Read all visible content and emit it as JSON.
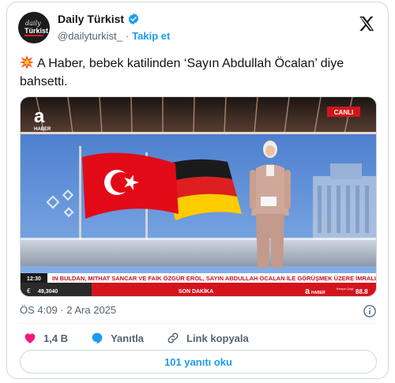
{
  "author": {
    "display_name": "Daily Türkist",
    "handle": "@dailyturkist_",
    "separator": "·",
    "follow_label": "Takip et",
    "avatar_line1": "daily",
    "avatar_line2": "Türkist"
  },
  "tweet": {
    "text": "A Haber, bebek katilinden ‘Sayın Abdullah Öcalan’ diye bahsetti."
  },
  "media": {
    "channel_logo": "a",
    "channel_sublabel": "HABER",
    "live_badge": "CANLI",
    "ticker_time": "12:30",
    "ticker_text": "IN BULDAN, MITHAT SANCAR VE FAİK ÖZGÜR EROL, SAYIN ABDULLAH ÖCALAN İLE GÖRÜŞMEK ÜZERE İMRALI",
    "euro_value": "49,3040",
    "son_dakika": "SON DAKİKA",
    "bottom_logo": "a",
    "bottom_logo_sub": "HABER",
    "small_label": "Kenya Çizgi",
    "right_value": "88.8"
  },
  "meta": {
    "timestamp": "ÖS 4:09 · 2 Ara 2025"
  },
  "actions": {
    "likes": "1,4 B",
    "reply_label": "Yanıtla",
    "copy_link_label": "Link kopyala"
  },
  "replies_button": "101 yanıtı oku",
  "colors": {
    "accent": "#1d9bf0",
    "like": "#f91880",
    "news_red": "#d4141c"
  }
}
